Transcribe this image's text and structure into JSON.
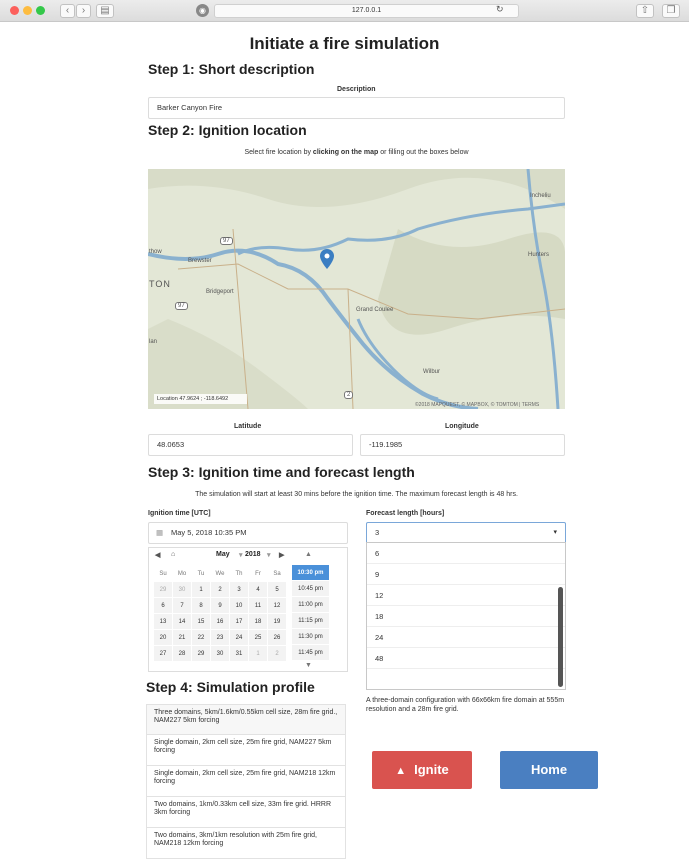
{
  "browser": {
    "url": "127.0.0.1"
  },
  "page": {
    "title": "Initiate a fire simulation",
    "step1": {
      "heading": "Step 1: Short description",
      "label": "Description",
      "value": "Barker Canyon Fire"
    },
    "step2": {
      "heading": "Step 2: Ignition location",
      "instruction_pre": "Select fire location by ",
      "instruction_bold": "clicking on the map",
      "instruction_post": " or filling out the boxes below",
      "map": {
        "location_readout": "Location 47.9624 ; -118.6492",
        "attribution": "©2018 MAPQUEST, © MAPBOX, © TOMTOM | TERMS",
        "places": [
          "Incheliu",
          "Brewster",
          "Bridgeport",
          "Grand Coulee",
          "Wilbur",
          "Hunters",
          "thow",
          "TON",
          "lan"
        ],
        "shields": [
          "97",
          "97",
          "2"
        ]
      },
      "latitude_label": "Latitude",
      "latitude_value": "48.0653",
      "longitude_label": "Longitude",
      "longitude_value": "-119.1985"
    },
    "step3": {
      "heading": "Step 3: Ignition time and forecast length",
      "note": "The simulation will start at least 30 mins before the ignition time. The maximum forecast length is 48 hrs.",
      "ignition_label": "Ignition time [UTC]",
      "ignition_value": "May 5, 2018 10:35 PM",
      "calendar": {
        "month": "May",
        "year": "2018",
        "weekdays": [
          "Su",
          "Mo",
          "Tu",
          "We",
          "Th",
          "Fr",
          "Sa"
        ],
        "weeks": [
          [
            "29",
            "30",
            "1",
            "2",
            "3",
            "4",
            "5"
          ],
          [
            "6",
            "7",
            "8",
            "9",
            "10",
            "11",
            "12"
          ],
          [
            "13",
            "14",
            "15",
            "16",
            "17",
            "18",
            "19"
          ],
          [
            "20",
            "21",
            "22",
            "23",
            "24",
            "25",
            "26"
          ],
          [
            "27",
            "28",
            "29",
            "30",
            "31",
            "1",
            "2"
          ]
        ],
        "times": [
          "10:30 pm",
          "10:45 pm",
          "11:00 pm",
          "11:15 pm",
          "11:30 pm",
          "11:45 pm"
        ]
      },
      "forecast_label": "Forecast length [hours]",
      "forecast_value": "3",
      "forecast_options": [
        "6",
        "9",
        "12",
        "18",
        "24",
        "48"
      ]
    },
    "step4": {
      "heading": "Step 4: Simulation profile",
      "profiles": [
        "Three domains, 5km/1.6km/0.55km cell size, 28m fire grid., NAM227 5km forcing",
        "Single domain, 2km cell size, 25m fire grid, NAM227 5km forcing",
        "Single domain, 2km cell size, 25m fire grid, NAM218 12km forcing",
        "Two domains, 1km/0.33km cell size, 33m fire grid. HRRR 3km forcing",
        "Two domains, 3km/1km resolution with 25m fire grid, NAM218 12km forcing"
      ],
      "profile_description": "A three-domain configuration with 66x66km fire domain at 555m resolution and a 28m fire grid."
    },
    "buttons": {
      "ignite": "Ignite",
      "home": "Home"
    }
  },
  "colors": {
    "ignite": "#d9534f",
    "home": "#4a7fc1",
    "selected_time": "#4a90d9"
  }
}
